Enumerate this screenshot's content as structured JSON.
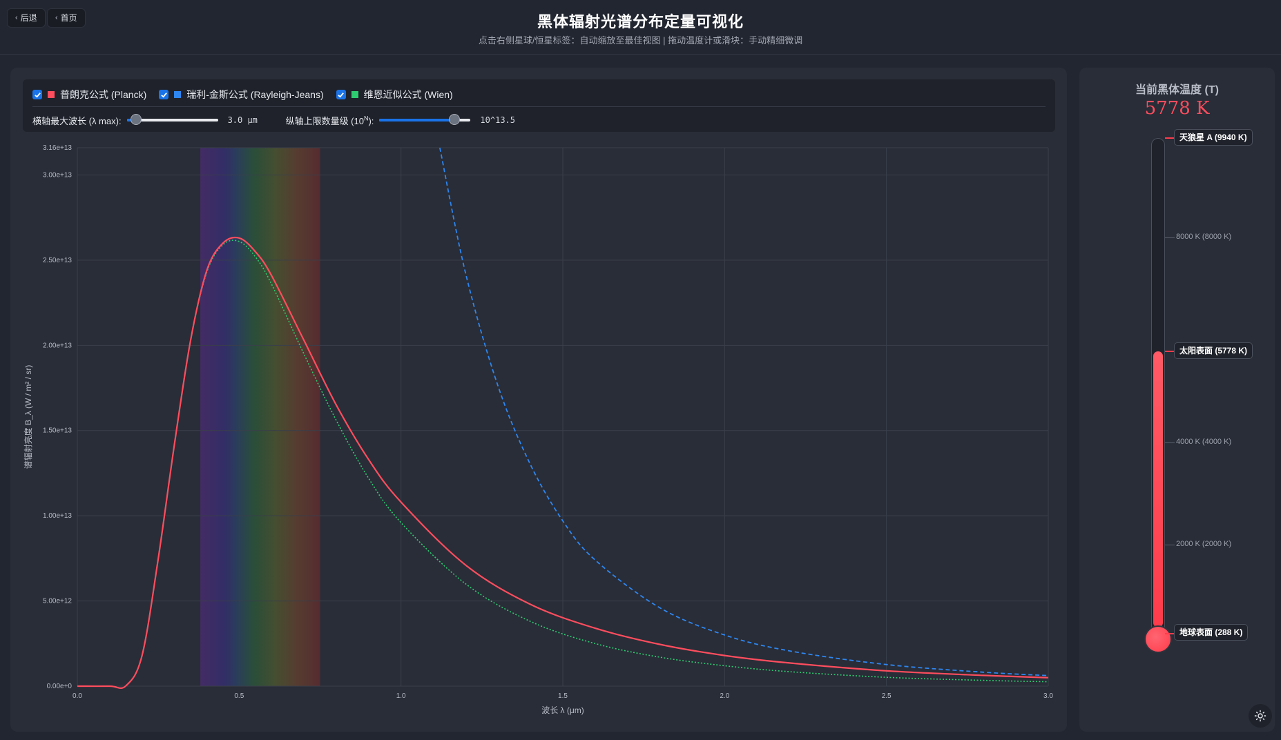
{
  "header": {
    "back_label": "后退",
    "home_label": "首页",
    "title": "黑体辐射光谱分布定量可视化",
    "subtitle": "点击右侧星球/恒星标签：自动缩放至最佳视图 | 拖动温度计或滑块：手动精细微调"
  },
  "legend": [
    {
      "label": "普朗克公式 (Planck)",
      "color": "#ff4d5e",
      "checked": true
    },
    {
      "label": "瑞利-金斯公式 (Rayleigh-Jeans)",
      "color": "#2e86f0",
      "checked": true
    },
    {
      "label": "维恩近似公式 (Wien)",
      "color": "#2ecc71",
      "checked": true
    }
  ],
  "controls": {
    "xmax_label": "横轴最大波长 (λ max):",
    "xmax_value": "3.0 μm",
    "xmax_fraction": 0.1,
    "ymax_label": "纵轴上限数量级 (10",
    "ymax_label_sup": "N",
    "ymax_label_end": "):",
    "ymax_value": "10^13.5",
    "ymax_fraction": 0.82
  },
  "chart_data": {
    "type": "line",
    "title": "",
    "xlabel": "波长 λ (μm)",
    "ylabel": "谱辐射亮度 B_λ (W / m² / sr)",
    "xlim": [
      0,
      3.0
    ],
    "ylim": [
      0,
      31600000000000.0
    ],
    "x_ticks": [
      "0.0",
      "0.5",
      "1.0",
      "1.5",
      "2.0",
      "2.5",
      "3.0"
    ],
    "y_ticks": [
      "0.00e+0",
      "5.00e+12",
      "1.00e+13",
      "1.50e+13",
      "2.00e+13",
      "2.50e+13",
      "3.00e+13",
      "3.16e+13"
    ],
    "y_tick_values": [
      0,
      5000000000000.0,
      10000000000000.0,
      15000000000000.0,
      20000000000000.0,
      25000000000000.0,
      30000000000000.0,
      31600000000000.0
    ],
    "grid": true,
    "visible_band_um": [
      0.38,
      0.75
    ],
    "temperature_K": 5778,
    "series": [
      {
        "name": "普朗克公式 (Planck)",
        "color": "#ff4d5e",
        "style": "solid",
        "x": [
          0.0,
          0.1,
          0.15,
          0.2,
          0.25,
          0.3,
          0.35,
          0.4,
          0.45,
          0.5,
          0.55,
          0.6,
          0.7,
          0.8,
          0.9,
          1.0,
          1.2,
          1.4,
          1.6,
          1.8,
          2.0,
          2.2,
          2.5,
          2.8,
          3.0
        ],
        "y": [
          0,
          0,
          20000000000.0,
          1800000000000.0,
          7500000000000.0,
          14200000000000.0,
          20300000000000.0,
          24400000000000.0,
          26000000000000.0,
          26300000000000.0,
          25500000000000.0,
          24100000000000.0,
          20300000000000.0,
          16500000000000.0,
          13300000000000.0,
          10800000000000.0,
          7100000000000.0,
          4800000000000.0,
          3400000000000.0,
          2450000000000.0,
          1800000000000.0,
          1360000000000.0,
          900000000000.0,
          630000000000.0,
          500000000000.0
        ]
      },
      {
        "name": "瑞利-金斯公式 (Rayleigh-Jeans)",
        "color": "#2e86f0",
        "style": "dashed",
        "x": [
          1.12,
          1.2,
          1.3,
          1.4,
          1.5,
          1.6,
          1.8,
          2.0,
          2.2,
          2.5,
          2.8,
          3.0
        ],
        "y": [
          31600000000000.0,
          24200000000000.0,
          17600000000000.0,
          13000000000000.0,
          9700000000000.0,
          7400000000000.0,
          4600000000000.0,
          3000000000000.0,
          2070000000000.0,
          1270000000000.0,
          820000000000.0,
          620000000000.0
        ]
      },
      {
        "name": "维恩近似公式 (Wien)",
        "color": "#2ecc71",
        "style": "dotted",
        "x": [
          0.0,
          0.1,
          0.15,
          0.2,
          0.25,
          0.3,
          0.35,
          0.4,
          0.45,
          0.5,
          0.55,
          0.6,
          0.7,
          0.8,
          0.9,
          1.0,
          1.2,
          1.4,
          1.6,
          1.8,
          2.0,
          2.2,
          2.5,
          2.8,
          3.0
        ],
        "y": [
          0,
          0,
          20000000000.0,
          1800000000000.0,
          7500000000000.0,
          14200000000000.0,
          20300000000000.0,
          24300000000000.0,
          25900000000000.0,
          26100000000000.0,
          25200000000000.0,
          23600000000000.0,
          19500000000000.0,
          15600000000000.0,
          12200000000000.0,
          9600000000000.0,
          6000000000000.0,
          3800000000000.0,
          2500000000000.0,
          1700000000000.0,
          1200000000000.0,
          850000000000.0,
          520000000000.0,
          340000000000.0,
          260000000000.0
        ]
      }
    ]
  },
  "thermometer": {
    "title": "当前黑体温度 (T)",
    "value": "5778 K",
    "min_K": 288,
    "max_K": 9940,
    "current_K": 5778,
    "fill_color": "#ff3b4b",
    "ticks": [
      "8000 K (8000 K)",
      "4000 K (4000 K)",
      "2000 K (2000 K)"
    ],
    "stars": [
      {
        "label": "天狼星 A (9940 K)"
      },
      {
        "label": "太阳表面 (5778 K)"
      },
      {
        "label": "地球表面 (288 K)"
      }
    ]
  }
}
